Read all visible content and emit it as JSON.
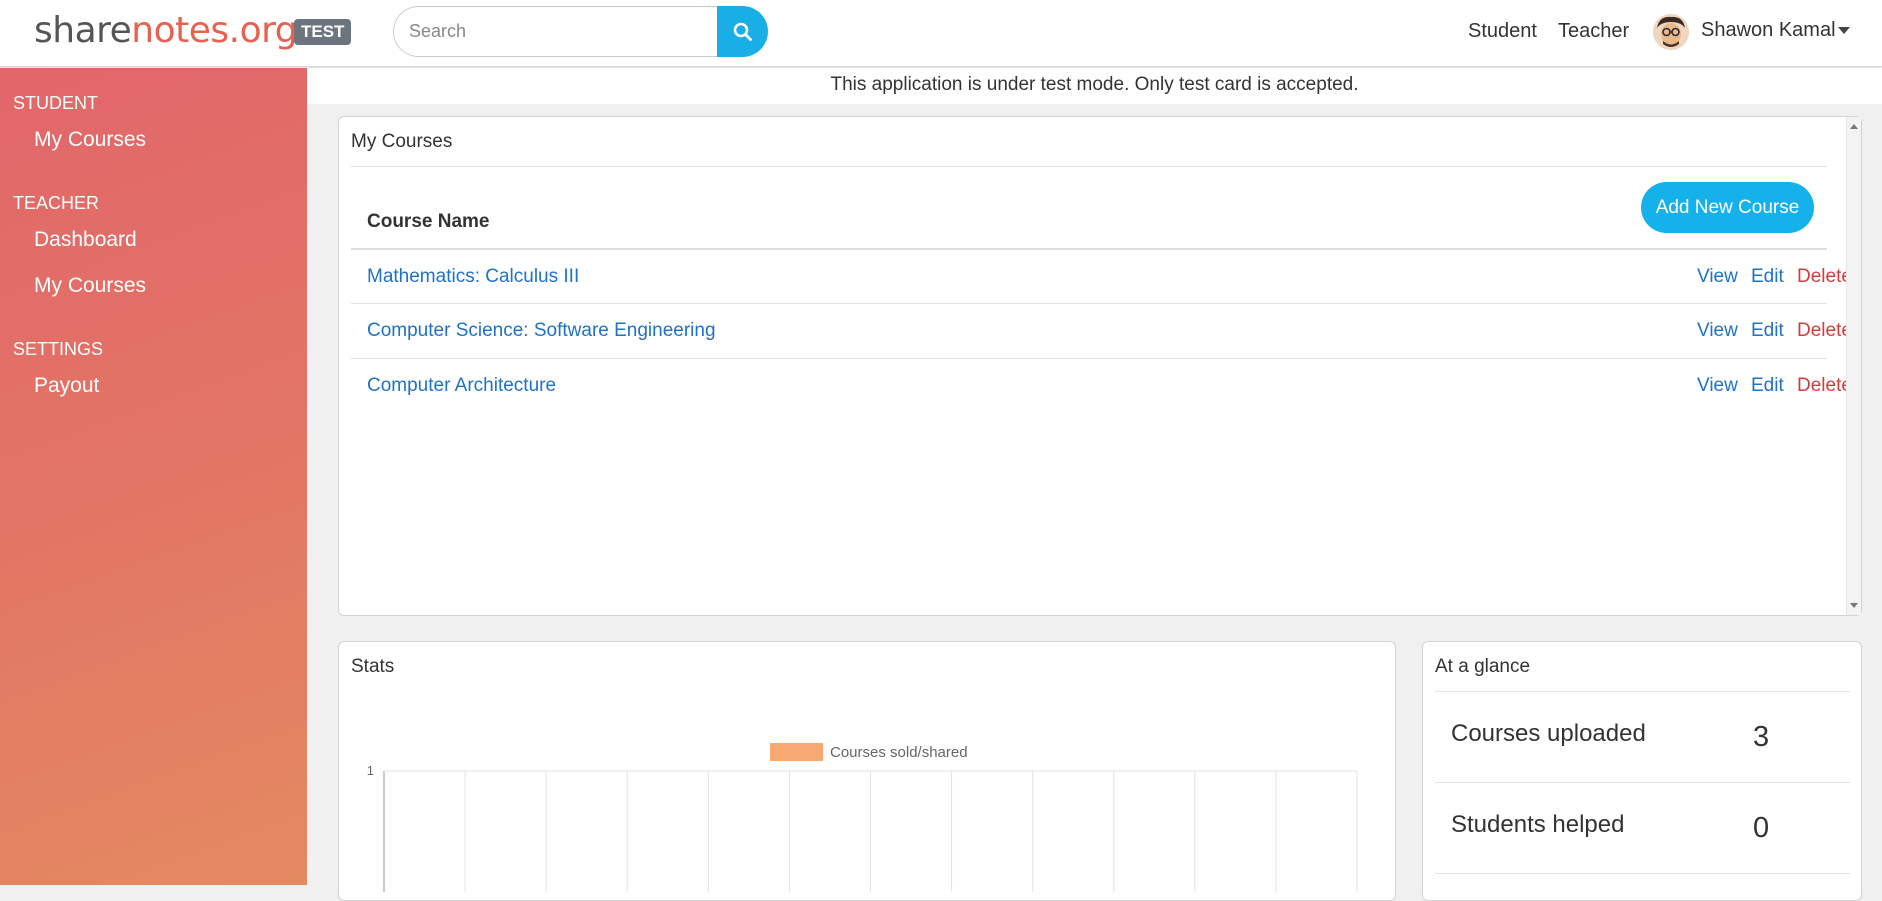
{
  "header": {
    "logo": {
      "share": "share",
      "notes": "notes",
      "org": ".org"
    },
    "badge": "TEST",
    "search": {
      "placeholder": "Search",
      "value": ""
    },
    "nav": {
      "student": "Student",
      "teacher": "Teacher"
    },
    "user": {
      "name": "Shawon Kamal"
    }
  },
  "sidebar": {
    "sections": [
      {
        "title": "STUDENT",
        "items": [
          {
            "label": "My Courses"
          }
        ]
      },
      {
        "title": "TEACHER",
        "items": [
          {
            "label": "Dashboard"
          },
          {
            "label": "My Courses"
          }
        ]
      },
      {
        "title": "SETTINGS",
        "items": [
          {
            "label": "Payout"
          }
        ]
      }
    ]
  },
  "notice": "This application is under test mode. Only test card is accepted.",
  "courses": {
    "title": "My Courses",
    "column_header": "Course Name",
    "add_button": "Add New Course",
    "actions": {
      "view": "View",
      "edit": "Edit",
      "delete": "Delete"
    },
    "rows": [
      {
        "name": "Mathematics: Calculus III"
      },
      {
        "name": "Computer Science: Software Engineering"
      },
      {
        "name": "Computer Architecture"
      }
    ]
  },
  "stats": {
    "title": "Stats"
  },
  "chart_data": {
    "type": "bar",
    "legend": [
      {
        "name": "Courses sold/shared",
        "color": "#f7a971"
      }
    ],
    "series": [
      {
        "name": "Courses sold/shared",
        "values": []
      }
    ],
    "yticks": [
      "1"
    ],
    "ylim": [
      0,
      1
    ],
    "grid": true,
    "legend_placement": "top-center",
    "x_gridlines": 13
  },
  "glance": {
    "title": "At a glance",
    "items": [
      {
        "label": "Courses uploaded",
        "value": "3"
      },
      {
        "label": "Students helped",
        "value": "0"
      }
    ]
  },
  "colors": {
    "accent": "#15b1ea",
    "link": "#1f72c6",
    "danger": "#d23c3c",
    "sidebar_start": "#e2666a",
    "sidebar_end": "#e48a61",
    "logo_accent": "#e8604f"
  },
  "icons": {
    "search": "search-icon",
    "user": "avatar",
    "dropdown": "caret-down-icon"
  }
}
